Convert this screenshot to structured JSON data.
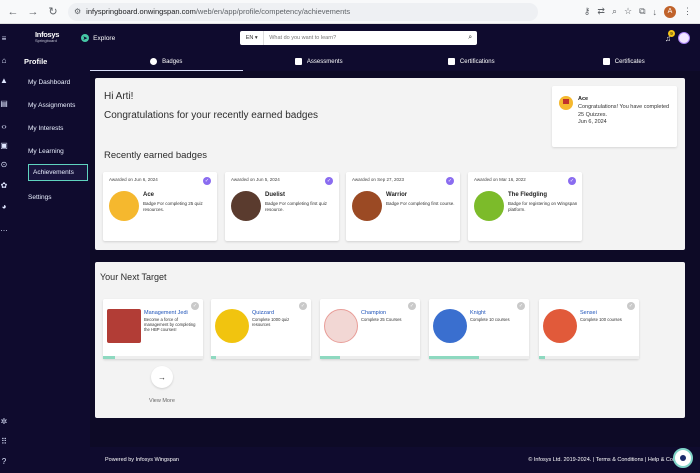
{
  "browser": {
    "url_host": "infyspringboard.onwingspan.com",
    "url_path": "/web/en/app/profile/competency/achievements",
    "profile_initial": "A"
  },
  "topbar": {
    "logo_line1": "Infosys",
    "logo_line2": "Springboard",
    "explore_label": "Explore",
    "lang": "EN ▾",
    "search_placeholder": "What do you want to learn?",
    "notification_count": "9"
  },
  "sidebar": {
    "heading": "Profile",
    "items": [
      {
        "label": "My Dashboard"
      },
      {
        "label": "My Assignments"
      },
      {
        "label": "My Interests"
      },
      {
        "label": "My Learning"
      },
      {
        "label": "Achievements"
      },
      {
        "label": "Settings"
      }
    ]
  },
  "tabs": [
    {
      "label": "Badges"
    },
    {
      "label": "Assessments"
    },
    {
      "label": "Certifications"
    },
    {
      "label": "Certificates"
    }
  ],
  "greeting": {
    "hi": "Hi Arti!",
    "congrats": "Congratulations for your recently earned badges"
  },
  "notification": {
    "title": "Ace",
    "message": "Congratulations! You have completed 25 Quizzes.",
    "date": "Jun 6, 2024"
  },
  "recent": {
    "heading": "Recently earned badges",
    "badges": [
      {
        "date": "Awarded on Jun 6, 2024",
        "name": "Ace",
        "desc": "Badge For completing 25 quiz resources.",
        "color": "#f5b82e"
      },
      {
        "date": "Awarded on Jun 5, 2024",
        "name": "Duelist",
        "desc": "Badge For completing first quiz resource.",
        "color": "#5a3b2e"
      },
      {
        "date": "Awarded on Sep 27, 2023",
        "name": "Warrior",
        "desc": "Badge For completing first course.",
        "color": "#9b4a24"
      },
      {
        "date": "Awarded on Mar 16, 2022",
        "name": "The Fledgling",
        "desc": "Badge for registering on Wingspan platform.",
        "color": "#7cbb2a"
      }
    ]
  },
  "next_target": {
    "heading": "Your Next Target",
    "targets": [
      {
        "name": "Management Jedi",
        "desc": "Become a force of management by completing the HBP courses!",
        "progress": 0.12,
        "color": "#b23d36"
      },
      {
        "name": "Quizzard",
        "desc": "Complete 1000 quiz resources",
        "progress": 0.05,
        "color": "#f1c40f"
      },
      {
        "name": "Champion",
        "desc": "Complete 25 Courses",
        "progress": 0.2,
        "color": "#f2d7d4"
      },
      {
        "name": "Knight",
        "desc": "Complete 10 courses",
        "progress": 0.5,
        "color": "#3a6fcf"
      },
      {
        "name": "Sensei",
        "desc": "Complete 100 courses",
        "progress": 0.06,
        "color": "#e15a3a"
      }
    ],
    "view_more": "View More"
  },
  "footer": {
    "powered": "Powered by Infosys Wingspan",
    "copyright": "© Infosys Ltd. 2019-2024. | Terms & Conditions | Help & Con"
  }
}
